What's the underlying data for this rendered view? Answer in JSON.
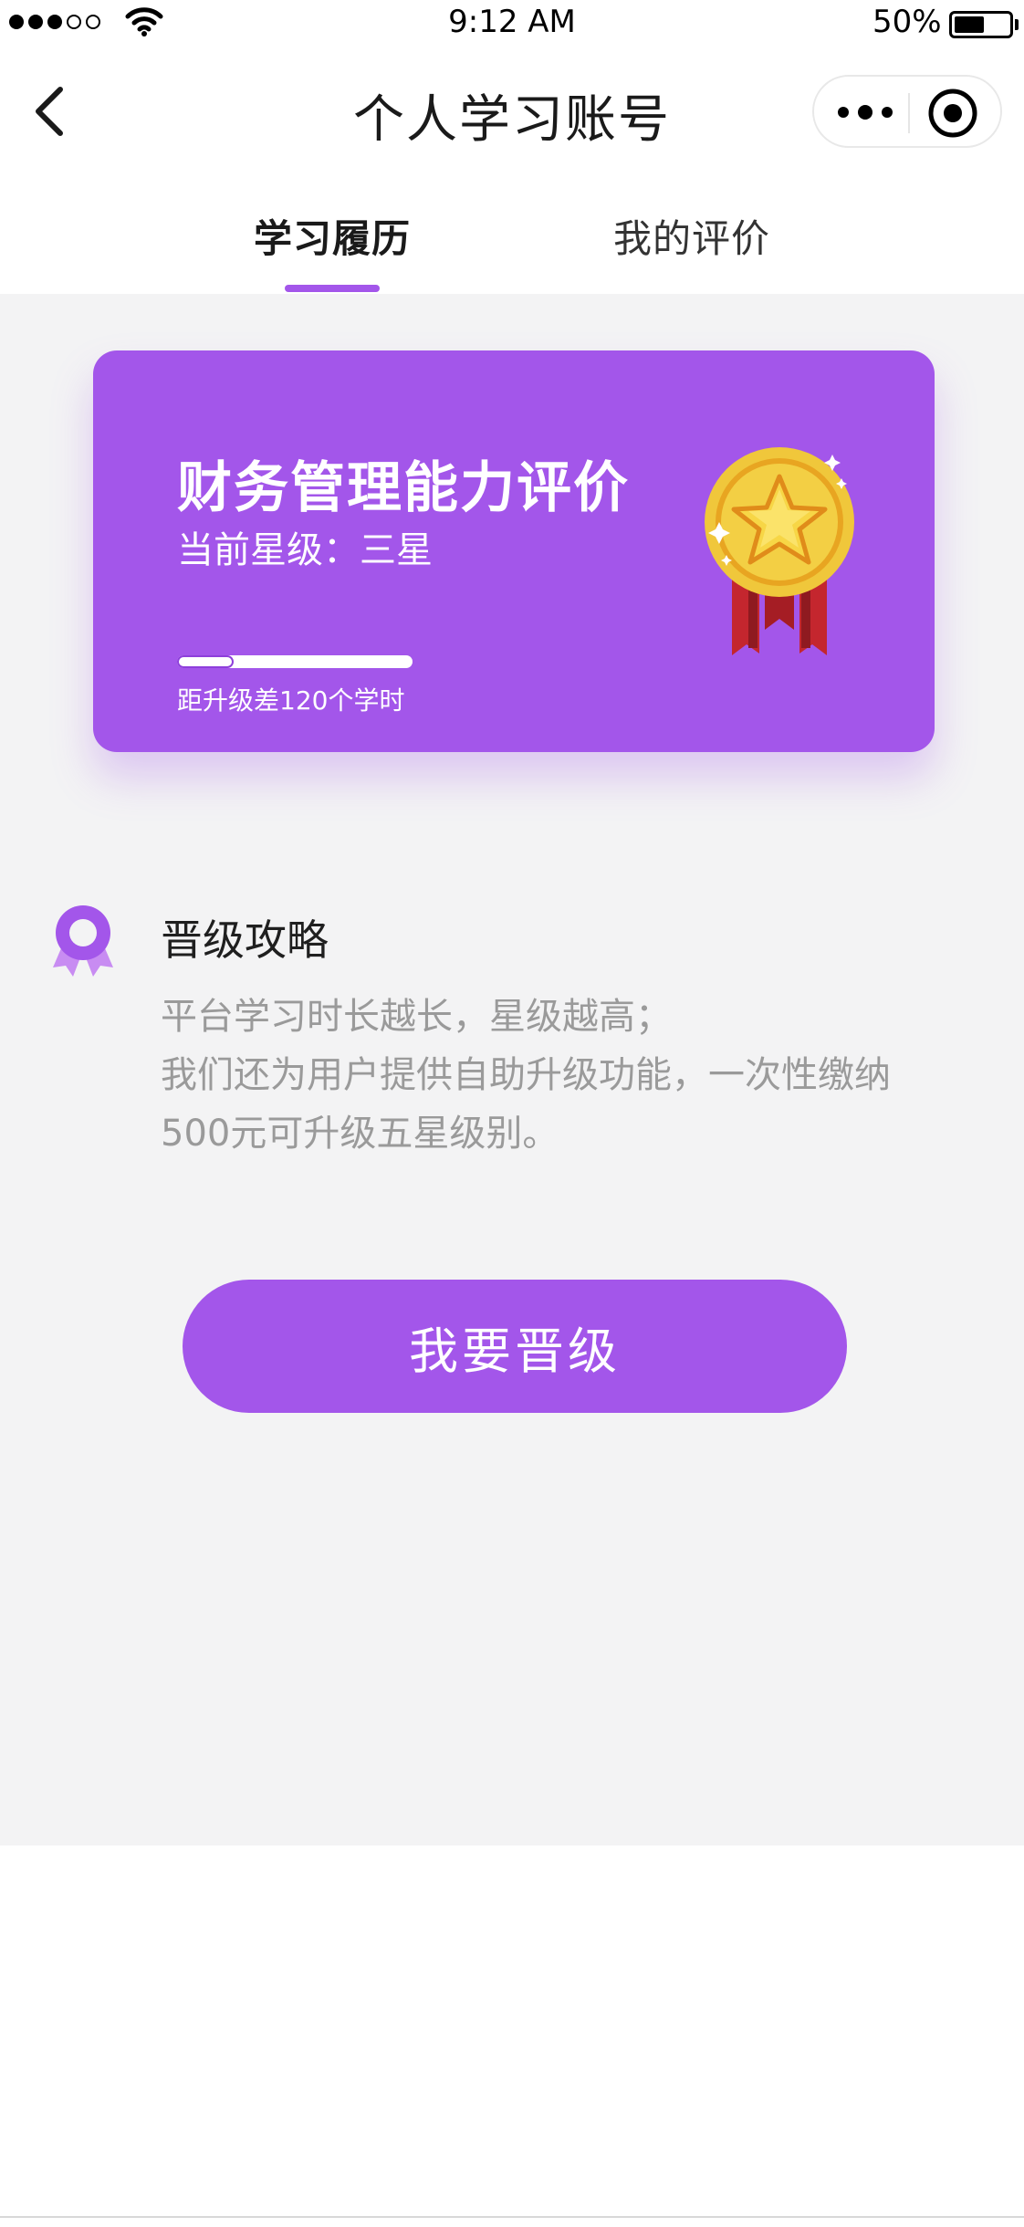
{
  "status_bar": {
    "time": "9:12 AM",
    "battery_percent": "50%",
    "battery_level": 0.5,
    "signal_strength": 3,
    "signal_max": 5
  },
  "nav": {
    "title": "个人学习账号",
    "back_icon": "chevron-left-icon",
    "more_icon": "more-dots-icon",
    "close_icon": "target-circle-icon"
  },
  "tabs": [
    {
      "label": "学习履历",
      "active": true
    },
    {
      "label": "我的评价",
      "active": false
    }
  ],
  "card": {
    "title": "财务管理能力评价",
    "level_text": "当前星级：三星",
    "progress": 0.24,
    "hint": "距升级差120个学时",
    "medal_icon": "gold-star-medal-icon"
  },
  "strategy": {
    "icon": "ribbon-badge-icon",
    "title": "晋级攻略",
    "lines": [
      "平台学习时长越长，星级越高；",
      "我们还为用户提供自助升级功能，一次性缴纳",
      "500元可升级五星级别。"
    ]
  },
  "actions": {
    "upgrade_label": "我要晋级"
  },
  "colors": {
    "accent": "#a356ea",
    "background": "#f3f3f4",
    "muted_text": "#9a9a9a"
  }
}
